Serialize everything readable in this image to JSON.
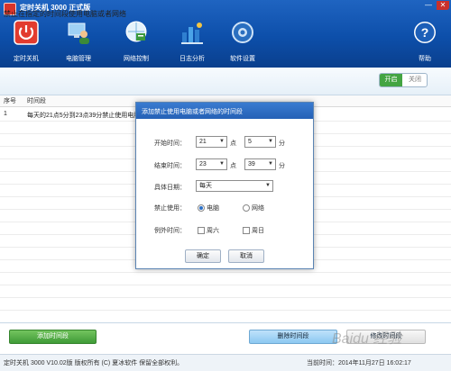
{
  "app": {
    "title": "定时关机 3000 正式版",
    "minimize": "—",
    "close": "✕"
  },
  "toolbar": [
    {
      "label": "定时关机",
      "icon": "power-icon"
    },
    {
      "label": "电脑管理",
      "icon": "computer-management-icon"
    },
    {
      "label": "网络控制",
      "icon": "network-control-icon"
    },
    {
      "label": "日志分析",
      "icon": "log-analysis-icon"
    },
    {
      "label": "软件设置",
      "icon": "settings-icon"
    },
    {
      "label": "帮助",
      "icon": "help-icon"
    }
  ],
  "main": {
    "title": "禁止在指定的时间段使用电脑或者网络",
    "toggle_on": "开启",
    "toggle_off": "关闭"
  },
  "table": {
    "headers": [
      "序号",
      "时间段"
    ],
    "rows": [
      {
        "index": "1",
        "period": "每天的21点5分到23点39分禁止使用电脑"
      }
    ]
  },
  "dialog": {
    "title": "添加禁止使用电脑或者网络的时间段",
    "start_label": "开始时间：",
    "start_hour": "21",
    "start_minute": "5",
    "end_label": "结束时间：",
    "end_hour": "23",
    "end_minute": "39",
    "hour_unit": "点",
    "minute_unit": "分",
    "date_label": "具体日期：",
    "date_value": "每天",
    "forbid_label": "禁止使用：",
    "forbid_options": [
      "电脑",
      "网络"
    ],
    "forbid_selected": "电脑",
    "exclude_label": "例外时间：",
    "exclude_options": [
      "周六",
      "周日"
    ],
    "ok": "确定",
    "cancel": "取消"
  },
  "footer": {
    "add_button": "添加时间段",
    "delete_button": "删除时间段",
    "modify_button": "修改时间段",
    "status_left": "定时关机 3000 V10.02版  版权所有 (C) 夏冰软件 保留全部权利。",
    "status_right": "当前时间：2014年11月27日 16:02:17"
  },
  "watermark": "Baidu 经验"
}
